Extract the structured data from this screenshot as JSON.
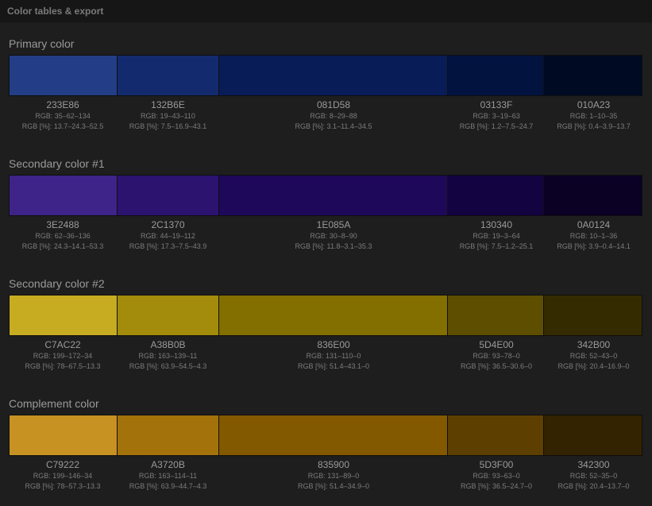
{
  "header": {
    "title": "Color tables & export"
  },
  "sections": [
    {
      "title": "Primary color",
      "swatches": [
        {
          "hex": "233E86",
          "color": "#233E86",
          "rgb": "RGB: 35–62–134",
          "rgbp": "RGB [%]: 13.7–24.3–52.5"
        },
        {
          "hex": "132B6E",
          "color": "#132B6E",
          "rgb": "RGB: 19–43–110",
          "rgbp": "RGB [%]: 7.5–16.9–43.1"
        },
        {
          "hex": "081D58",
          "color": "#081D58",
          "rgb": "RGB: 8–29–88",
          "rgbp": "RGB [%]: 3.1–11.4–34.5"
        },
        {
          "hex": "03133F",
          "color": "#03133F",
          "rgb": "RGB: 3–19–63",
          "rgbp": "RGB [%]: 1.2–7.5–24.7"
        },
        {
          "hex": "010A23",
          "color": "#010A23",
          "rgb": "RGB: 1–10–35",
          "rgbp": "RGB [%]: 0.4–3.9–13.7"
        }
      ]
    },
    {
      "title": "Secondary color #1",
      "swatches": [
        {
          "hex": "3E2488",
          "color": "#3E2488",
          "rgb": "RGB: 62–36–136",
          "rgbp": "RGB [%]: 24.3–14.1–53.3"
        },
        {
          "hex": "2C1370",
          "color": "#2C1370",
          "rgb": "RGB: 44–19–112",
          "rgbp": "RGB [%]: 17.3–7.5–43.9"
        },
        {
          "hex": "1E085A",
          "color": "#1E085A",
          "rgb": "RGB: 30–8–90",
          "rgbp": "RGB [%]: 11.8–3.1–35.3"
        },
        {
          "hex": "130340",
          "color": "#130340",
          "rgb": "RGB: 19–3–64",
          "rgbp": "RGB [%]: 7.5–1.2–25.1"
        },
        {
          "hex": "0A0124",
          "color": "#0A0124",
          "rgb": "RGB: 10–1–36",
          "rgbp": "RGB [%]: 3.9–0.4–14.1"
        }
      ]
    },
    {
      "title": "Secondary color #2",
      "swatches": [
        {
          "hex": "C7AC22",
          "color": "#C7AC22",
          "rgb": "RGB: 199–172–34",
          "rgbp": "RGB [%]: 78–67.5–13.3"
        },
        {
          "hex": "A38B0B",
          "color": "#A38B0B",
          "rgb": "RGB: 163–139–11",
          "rgbp": "RGB [%]: 63.9–54.5–4.3"
        },
        {
          "hex": "836E00",
          "color": "#836E00",
          "rgb": "RGB: 131–110–0",
          "rgbp": "RGB [%]: 51.4–43.1–0"
        },
        {
          "hex": "5D4E00",
          "color": "#5D4E00",
          "rgb": "RGB: 93–78–0",
          "rgbp": "RGB [%]: 36.5–30.6–0"
        },
        {
          "hex": "342B00",
          "color": "#342B00",
          "rgb": "RGB: 52–43–0",
          "rgbp": "RGB [%]: 20.4–16.9–0"
        }
      ]
    },
    {
      "title": "Complement color",
      "swatches": [
        {
          "hex": "C79222",
          "color": "#C79222",
          "rgb": "RGB: 199–146–34",
          "rgbp": "RGB [%]: 78–57.3–13.3"
        },
        {
          "hex": "A3720B",
          "color": "#A3720B",
          "rgb": "RGB: 163–114–11",
          "rgbp": "RGB [%]: 63.9–44.7–4.3"
        },
        {
          "hex": "835900",
          "color": "#835900",
          "rgb": "RGB: 131–89–0",
          "rgbp": "RGB [%]: 51.4–34.9–0"
        },
        {
          "hex": "5D3F00",
          "color": "#5D3F00",
          "rgb": "RGB: 93–63–0",
          "rgbp": "RGB [%]: 36.5–24.7–0"
        },
        {
          "hex": "342300",
          "color": "#342300",
          "rgb": "RGB: 52–35–0",
          "rgbp": "RGB [%]: 20.4–13.7–0"
        }
      ]
    }
  ]
}
